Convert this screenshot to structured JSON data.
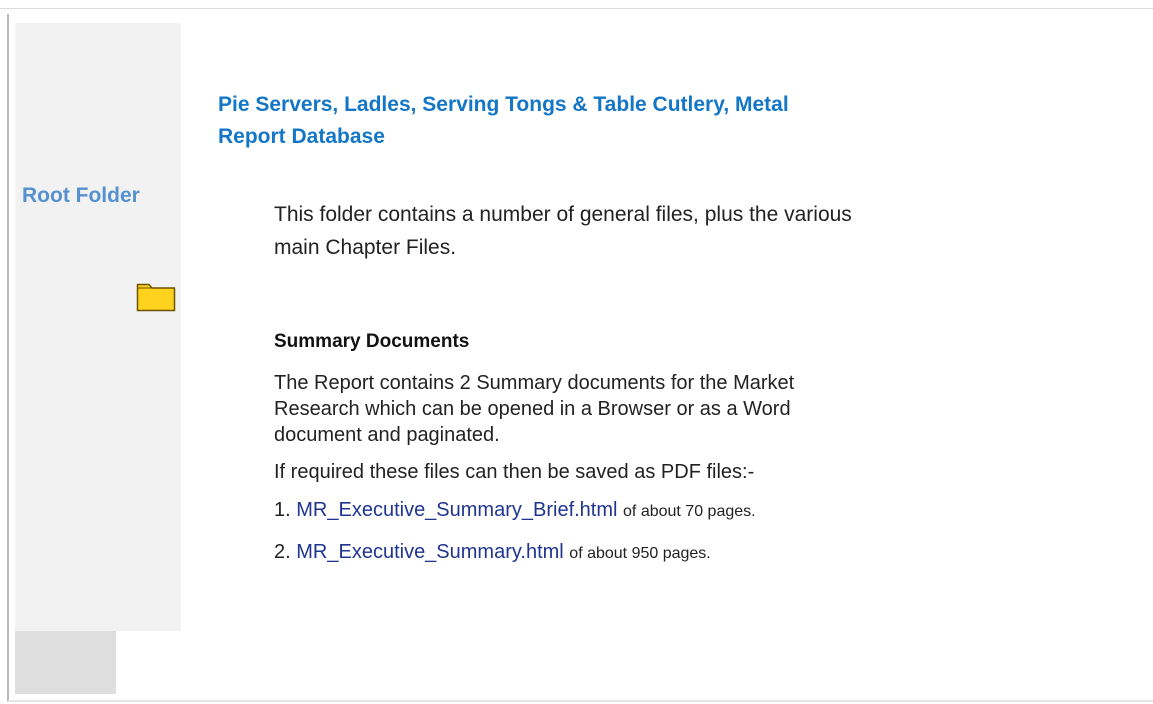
{
  "colors": {
    "title": "#1476c6",
    "sidebar_title": "#5591d0",
    "link": "#1f3590",
    "sidebar_bg": "#f2f2f2",
    "folder_fill": "#ffd21e",
    "folder_stroke": "#6b5200"
  },
  "sidebar": {
    "title": "Root Folder",
    "icon": "folder-icon"
  },
  "main": {
    "title": "Pie Servers, Ladles, Serving Tongs & Table Cutlery, Metal Report Database",
    "intro": "This folder contains a number of general files, plus the various main Chapter Files.",
    "section_heading": "Summary Documents",
    "summary_text": "The Report contains 2 Summary documents for the Market Research which can be opened in a Browser or as a Word document and paginated.",
    "pdf_note": "If required these files can then be saved as PDF files:-",
    "documents": [
      {
        "number": "1.",
        "link": "MR_Executive_Summary_Brief.html",
        "pages": "of about 70 pages."
      },
      {
        "number": "2.",
        "link": "MR_Executive_Summary.html",
        "pages": "of about 950 pages."
      }
    ]
  }
}
